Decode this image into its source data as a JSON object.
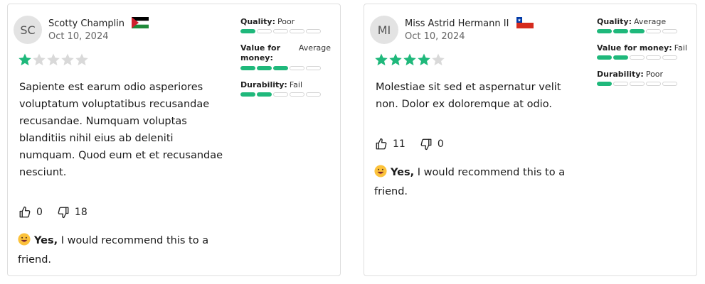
{
  "reviews": [
    {
      "initials": "SC",
      "name": "Scotty Champlin",
      "flag": "palestine-flag",
      "date": "Oct 10, 2024",
      "stars": 1,
      "body": "Sapiente est earum odio asperiores voluptatum voluptatibus recusandae recusandae. Numquam voluptas blanditiis nihil eius ab deleniti numquam. Quod eum et et recusandae nesciunt.",
      "likes": "0",
      "dislikes": "18",
      "recommend_yes": "Yes,",
      "recommend_text": "I would recommend this to a friend.",
      "ratings": [
        {
          "label": "Quality:",
          "value": "Poor",
          "level": 1
        },
        {
          "label": "Value for money:",
          "value": "Average",
          "level": 3
        },
        {
          "label": "Durability:",
          "value": "Fail",
          "level": 2
        }
      ]
    },
    {
      "initials": "MI",
      "name": "Miss Astrid Hermann II",
      "flag": "chile-flag",
      "date": "Oct 10, 2024",
      "stars": 4,
      "body": "Molestiae sit sed et aspernatur velit non. Dolor ex doloremque at odio.",
      "likes": "11",
      "dislikes": "0",
      "recommend_yes": "Yes,",
      "recommend_text": "I would recommend this to a friend.",
      "ratings": [
        {
          "label": "Quality:",
          "value": "Average",
          "level": 3
        },
        {
          "label": "Value for money:",
          "value": "Fail",
          "level": 2
        },
        {
          "label": "Durability:",
          "value": "Poor",
          "level": 1
        }
      ]
    }
  ],
  "colors": {
    "accent": "#1fb87b",
    "star_off": "#d9d9d9"
  },
  "segments_total": 5
}
